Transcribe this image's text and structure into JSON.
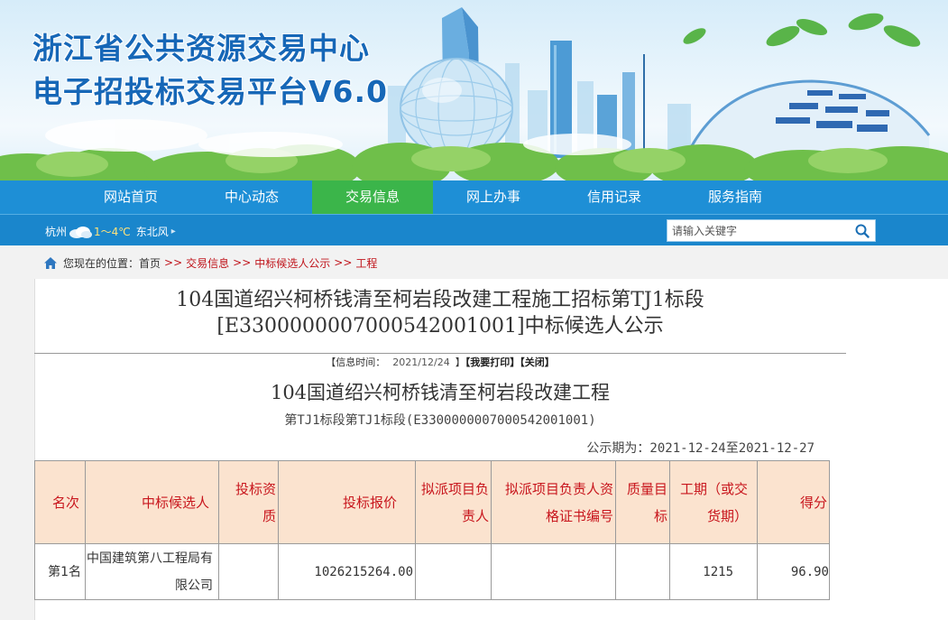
{
  "site": {
    "title_line1": "浙江省公共资源交易中心",
    "title_line2": "电子招投标交易平台V6.0"
  },
  "nav": {
    "items": [
      {
        "label": "网站首页",
        "active": false
      },
      {
        "label": "中心动态",
        "active": false
      },
      {
        "label": "交易信息",
        "active": true
      },
      {
        "label": "网上办事",
        "active": false
      },
      {
        "label": "信用记录",
        "active": false
      },
      {
        "label": "服务指南",
        "active": false
      }
    ]
  },
  "weather": {
    "city": "杭州",
    "temp": "1～4℃",
    "wind": "东北风",
    "icon": "cloud-icon"
  },
  "search": {
    "placeholder": "请输入关键字",
    "icon": "search-icon"
  },
  "breadcrumb": {
    "prefix": "您现在的位置：首页",
    "items": [
      "交易信息",
      "中标候选人公示",
      "工程"
    ],
    "separator": ">>"
  },
  "document": {
    "title": "104国道绍兴柯桥钱清至柯岩段改建工程施工招标第TJ1标段[E3300000007000542001001]中标候选人公示",
    "info_label": "【信息时间：",
    "info_date": "2021/12/24",
    "info_close_bracket": "】",
    "print_label": "【我要打印】",
    "close_label": "【关闭】",
    "project_name": "104国道绍兴柯桥钱清至柯岩段改建工程",
    "section_label": "第TJ1标段第TJ1标段(E3300000007000542001001)",
    "period": "公示期为：2021-12-24至2021-12-27"
  },
  "table": {
    "headers": [
      "名次",
      "中标候选人",
      "投标资质",
      "投标报价",
      "拟派项目负责人",
      "拟派项目负责人资格证书编号",
      "质量目标",
      "工期（或交货期）",
      "得分"
    ],
    "rows": [
      {
        "rank": "第1名",
        "candidate": "中国建筑第八工程局有限公司",
        "qualification": "",
        "bid_price": "1026215264.00",
        "manager": "",
        "manager_cert": "",
        "quality": "",
        "duration": "1215",
        "score": "96.90"
      }
    ]
  },
  "colors": {
    "nav_bg": "#1e8fd6",
    "nav_active": "#3bb54a",
    "subbar_bg": "#1a86cc",
    "title_blue": "#1667b7",
    "table_header_bg": "#fbe3cf",
    "table_header_text": "#c8161d",
    "breadcrumb_link": "#c0141b"
  }
}
